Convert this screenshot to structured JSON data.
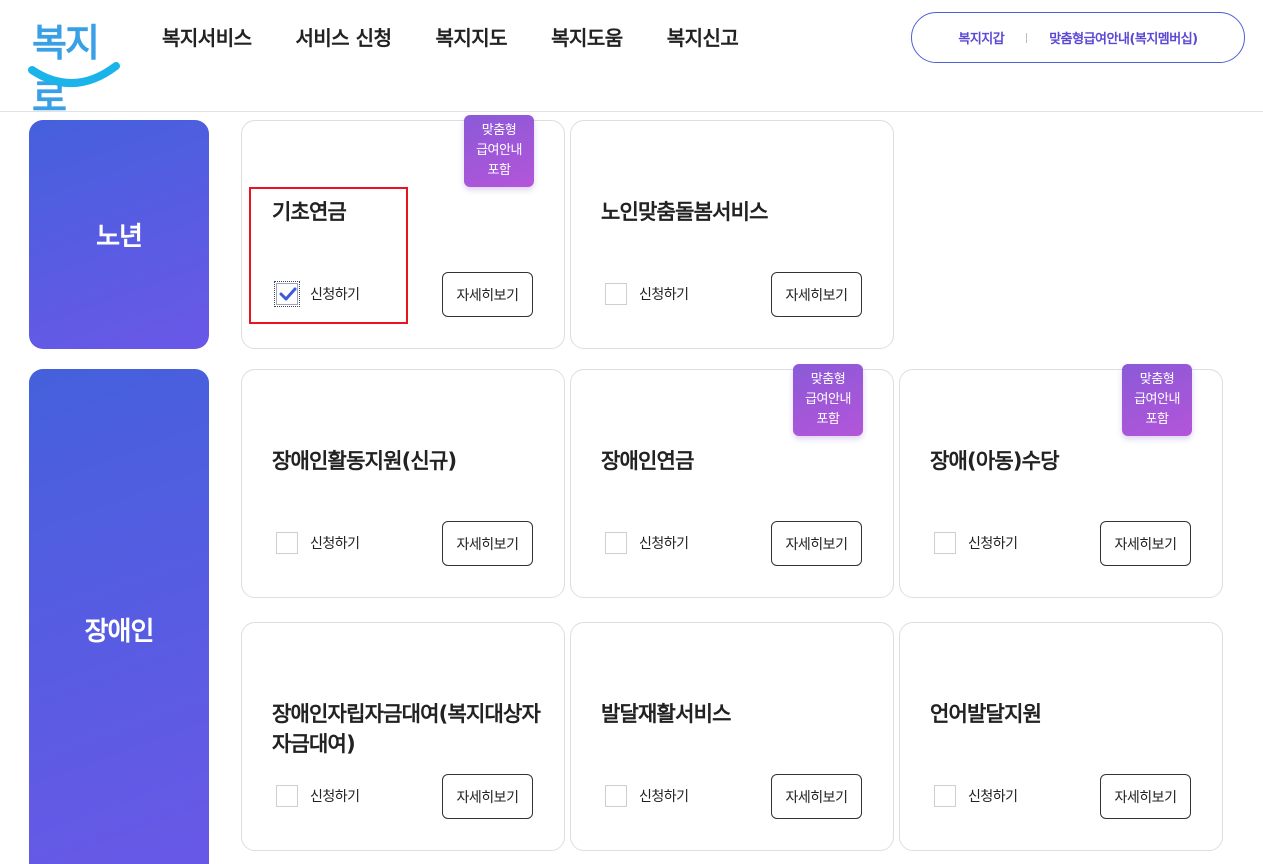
{
  "header": {
    "logo_text": "복지로",
    "nav": [
      "복지서비스",
      "서비스 신청",
      "복지지도",
      "복지도움",
      "복지신고"
    ],
    "util": [
      "복지지갑",
      "맞춤형급여안내(복지멤버십)"
    ]
  },
  "common": {
    "apply_label": "신청하기",
    "detail_label": "자세히보기",
    "badge_lines": [
      "맞춤형",
      "급여안내",
      "포함"
    ]
  },
  "categories": [
    {
      "name": "노년",
      "cards": [
        {
          "title": "기초연금",
          "badge": true,
          "checked": true
        },
        {
          "title": "노인맞춤돌봄서비스",
          "badge": false,
          "checked": false
        }
      ]
    },
    {
      "name": "장애인",
      "cards": [
        {
          "title": "장애인활동지원(신규)",
          "badge": false,
          "checked": false
        },
        {
          "title": "장애인연금",
          "badge": true,
          "checked": false
        },
        {
          "title": "장애(아동)수당",
          "badge": true,
          "checked": false
        },
        {
          "title": "장애인자립자금대여(복지대상자자금대여)",
          "badge": false,
          "checked": false
        },
        {
          "title": "발달재활서비스",
          "badge": false,
          "checked": false
        },
        {
          "title": "언어발달지원",
          "badge": false,
          "checked": false
        }
      ]
    }
  ],
  "colors": {
    "accent": "#4f5fd6",
    "category_gradient_start": "#4560dc",
    "category_gradient_end": "#6a58e8",
    "badge_gradient_start": "#8a5ad8",
    "badge_gradient_end": "#b455d9",
    "highlight": "#e8141e"
  }
}
